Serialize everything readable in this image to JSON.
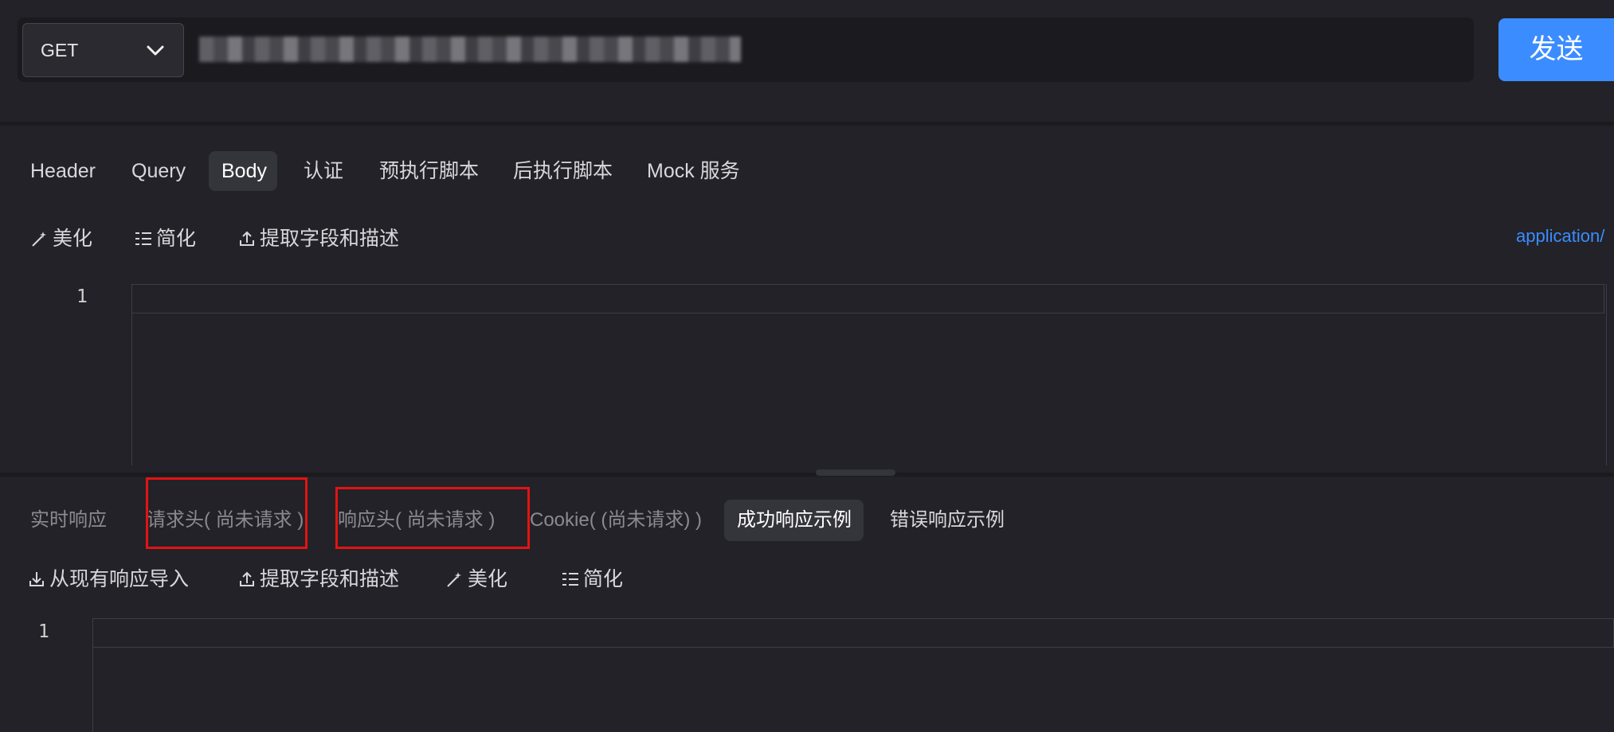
{
  "request": {
    "method": "GET",
    "send_label": "发送",
    "url_value": "",
    "url_placeholder": ""
  },
  "request_tabs": [
    {
      "label": "Header"
    },
    {
      "label": "Query"
    },
    {
      "label": "Body",
      "active": true
    },
    {
      "label": "认证"
    },
    {
      "label": "预执行脚本"
    },
    {
      "label": "后执行脚本"
    },
    {
      "label": "Mock 服务"
    }
  ],
  "body_toolbar": {
    "beautify": "美化",
    "simplify": "简化",
    "extract": "提取字段和描述",
    "content_type": "application/"
  },
  "body_editor": {
    "line_number": "1"
  },
  "response_tabs": [
    {
      "label": "实时响应"
    },
    {
      "label": "请求头( 尚未请求 )"
    },
    {
      "label": "响应头( 尚未请求 )"
    },
    {
      "label": "Cookie( (尚未请求) )"
    },
    {
      "label": "成功响应示例",
      "active": true
    },
    {
      "label": "错误响应示例"
    }
  ],
  "response_toolbar": {
    "import": "从现有响应导入",
    "extract": "提取字段和描述",
    "beautify": "美化",
    "simplify": "简化"
  },
  "response_editor": {
    "line_number": "1"
  },
  "colors": {
    "background": "#222228",
    "accent": "#3b8cff",
    "highlight": "#e31313"
  },
  "icons": {
    "chevron": "chevron-down-icon",
    "beautify": "magic-wand-icon",
    "simplify": "list-icon",
    "extract": "upload-icon",
    "import": "download-icon"
  }
}
